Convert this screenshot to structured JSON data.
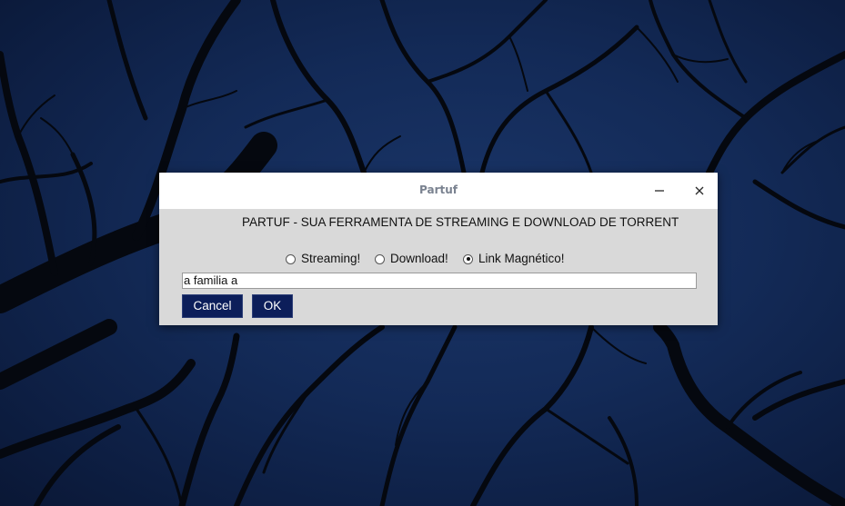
{
  "window": {
    "title": "Partuf",
    "minimize_icon": "minimize-icon",
    "close_icon": "close-icon"
  },
  "heading": "PARTUF - SUA FERRAMENTA DE STREAMING E DOWNLOAD DE TORRENT",
  "mode_options": [
    {
      "label": "Streaming!",
      "checked": false
    },
    {
      "label": "Download!",
      "checked": false
    },
    {
      "label": "Link Magnético!",
      "checked": true
    }
  ],
  "search": {
    "value": "a familia a"
  },
  "buttons": {
    "cancel_label": "Cancel",
    "ok_label": "OK"
  },
  "colors": {
    "desktop_bg": "#132a57",
    "button_bg": "#0c1e5a",
    "dialog_bg": "#d9d9d9"
  }
}
